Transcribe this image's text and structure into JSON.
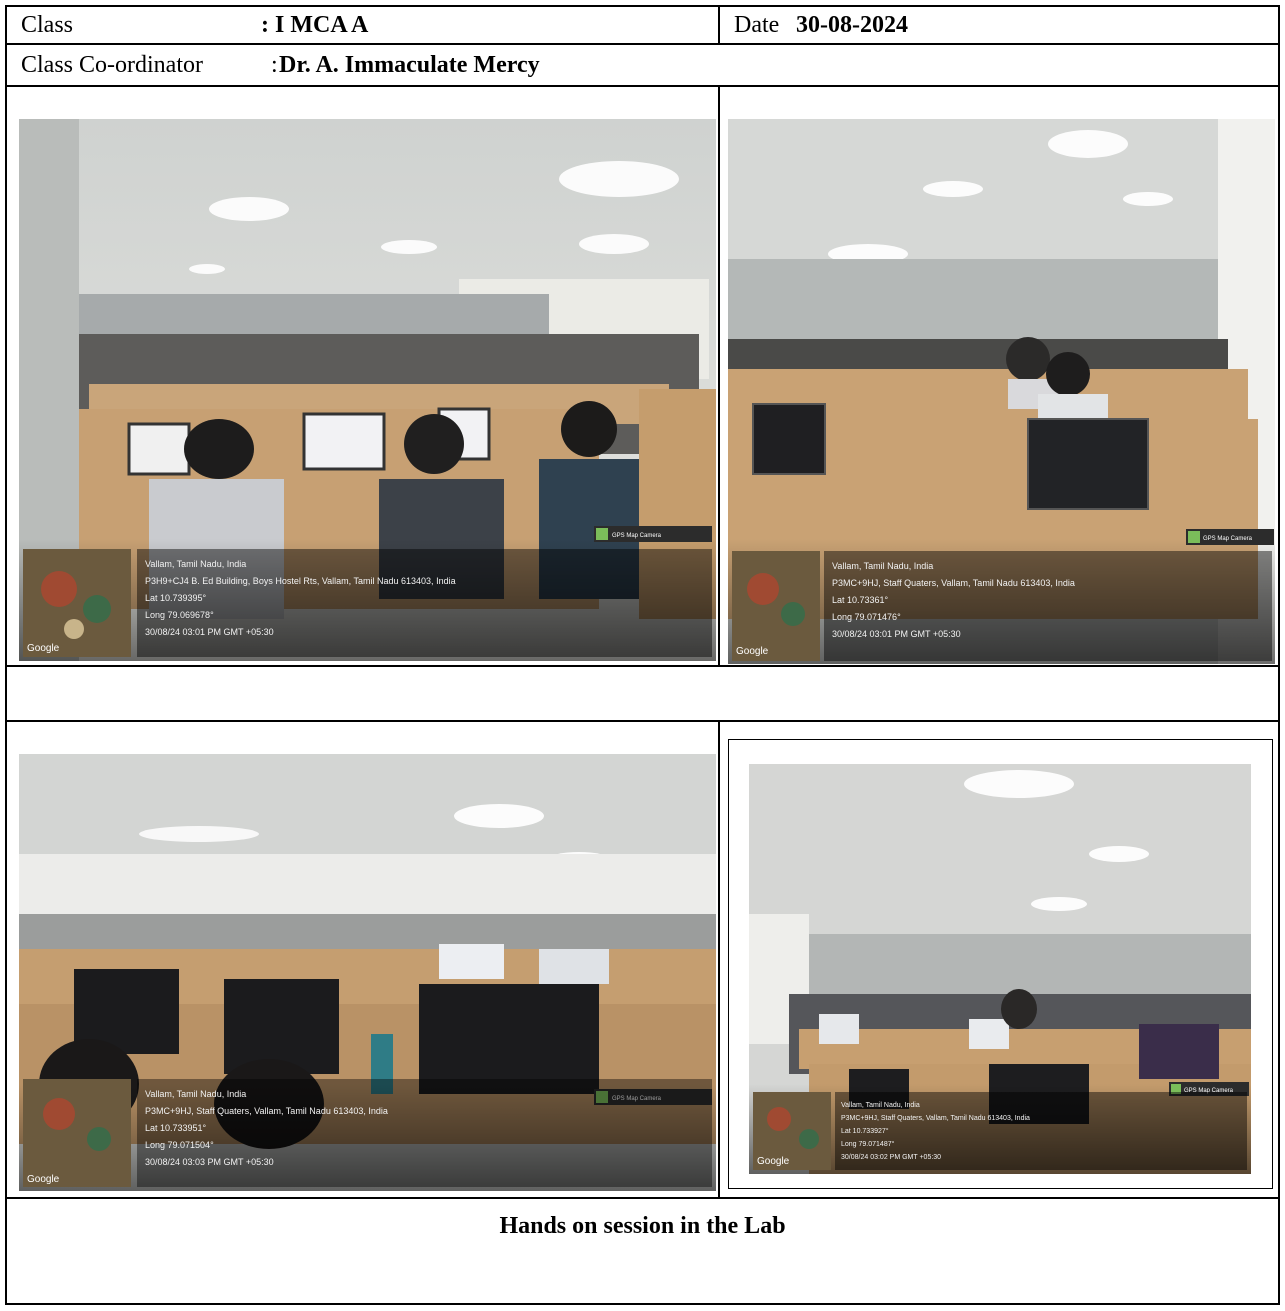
{
  "header": {
    "class_label": "Class",
    "class_value": ": I MCA A",
    "date_label": "Date",
    "date_value": "30-08-2024",
    "coordinator_label": "Class Co-ordinator",
    "coordinator_sep": ":",
    "coordinator_name": "Dr. A. Immaculate Mercy"
  },
  "photos": [
    {
      "location_title": "Vallam, Tamil Nadu, India",
      "address": "P3H9+CJ4 B. Ed Building, Boys Hostel Rts, Vallam, Tamil Nadu 613403, India",
      "lat": "Lat 10.739395°",
      "long": "Long 79.069678°",
      "timestamp": "30/08/24 03:01 PM GMT +05:30",
      "badge": "GPS Map Camera",
      "map_brand": "Google"
    },
    {
      "location_title": "Vallam, Tamil Nadu, India",
      "address": "P3MC+9HJ, Staff Quaters, Vallam, Tamil Nadu 613403, India",
      "lat": "Lat 10.73361°",
      "long": "Long 79.071476°",
      "timestamp": "30/08/24 03:01 PM GMT +05:30",
      "badge": "GPS Map Camera",
      "map_brand": "Google"
    },
    {
      "location_title": "Vallam, Tamil Nadu, India",
      "address": "P3MC+9HJ, Staff Quaters, Vallam, Tamil Nadu 613403, India",
      "lat": "Lat 10.733951°",
      "long": "Long 79.071504°",
      "timestamp": "30/08/24 03:03 PM GMT +05:30",
      "badge": "GPS Map Camera",
      "map_brand": "Google"
    },
    {
      "location_title": "Vallam, Tamil Nadu, India",
      "address": "P3MC+9HJ, Staff Quaters, Vallam, Tamil Nadu 613403, India",
      "lat": "Lat 10.733927°",
      "long": "Long 79.071487°",
      "timestamp": "30/08/24 03:02 PM GMT +05:30",
      "badge": "GPS Map Camera",
      "map_brand": "Google"
    }
  ],
  "caption": "Hands on session in the Lab"
}
